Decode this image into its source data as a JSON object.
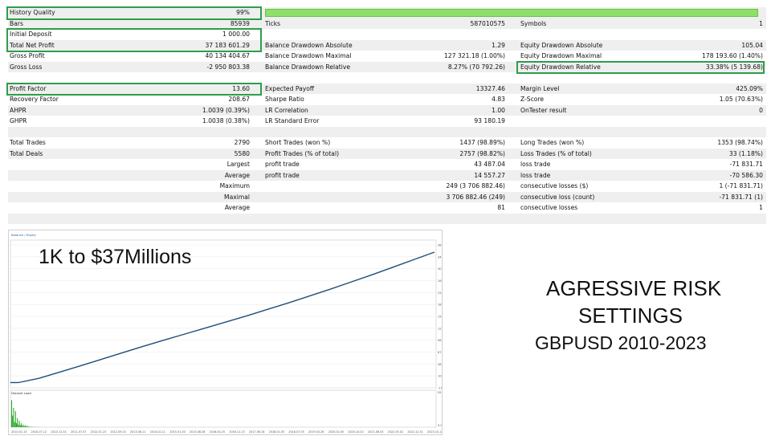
{
  "report": {
    "rows": [
      {
        "shade": true,
        "c1l": "History Quality",
        "c1v": "99%",
        "c2l": "",
        "c2v": "",
        "c3l": "",
        "c3v": "",
        "quality_fraction": 0.99
      },
      {
        "shade": true,
        "c1l": "Bars",
        "c1v": "85939",
        "c2l": "Ticks",
        "c2v": "587010575",
        "c3l": "Symbols",
        "c3v": "1"
      },
      {
        "shade": false,
        "c1l": "Initial Deposit",
        "c1v": "1 000.00",
        "c2l": "",
        "c2v": "",
        "c3l": "",
        "c3v": ""
      },
      {
        "shade": true,
        "c1l": "Total Net Profit",
        "c1v": "37 183 601.29",
        "c2l": "Balance Drawdown Absolute",
        "c2v": "1.29",
        "c3l": "Equity Drawdown Absolute",
        "c3v": "105.04"
      },
      {
        "shade": false,
        "c1l": "Gross Profit",
        "c1v": "40 134 404.67",
        "c2l": "Balance Drawdown Maximal",
        "c2v": "127 321.18 (1.00%)",
        "c3l": "Equity Drawdown Maximal",
        "c3v": "178 193.60 (1.40%)"
      },
      {
        "shade": true,
        "c1l": "Gross Loss",
        "c1v": "-2 950 803.38",
        "c2l": "Balance Drawdown Relative",
        "c2v": "8.27% (70 792.26)",
        "c3l": "Equity Drawdown Relative",
        "c3v": "33.38% (5 139.68)"
      },
      {
        "shade": false,
        "c1l": "",
        "c1v": "",
        "c2l": "",
        "c2v": "",
        "c3l": "",
        "c3v": ""
      },
      {
        "shade": true,
        "c1l": "Profit Factor",
        "c1v": "13.60",
        "c2l": "Expected Payoff",
        "c2v": "13327.46",
        "c3l": "Margin Level",
        "c3v": "425.09%"
      },
      {
        "shade": false,
        "c1l": "Recovery Factor",
        "c1v": "208.67",
        "c2l": "Sharpe Ratio",
        "c2v": "4.83",
        "c3l": "Z-Score",
        "c3v": "1.05 (70.63%)"
      },
      {
        "shade": true,
        "c1l": "AHPR",
        "c1v": "1.0039 (0.39%)",
        "c2l": "LR Correlation",
        "c2v": "1.00",
        "c3l": "OnTester result",
        "c3v": "0"
      },
      {
        "shade": false,
        "c1l": "GHPR",
        "c1v": "1.0038 (0.38%)",
        "c2l": "LR Standard Error",
        "c2v": "93 180.19",
        "c3l": "",
        "c3v": ""
      },
      {
        "shade": true,
        "c1l": "",
        "c1v": "",
        "c2l": "",
        "c2v": "",
        "c3l": "",
        "c3v": ""
      },
      {
        "shade": false,
        "c1l": "Total Trades",
        "c1v": "2790",
        "c2l": "Short Trades (won %)",
        "c2v": "1437 (98.89%)",
        "c3l": "Long Trades (won %)",
        "c3v": "1353 (98.74%)"
      },
      {
        "shade": true,
        "c1l": "Total Deals",
        "c1v": "5580",
        "c2l": "Profit Trades (% of total)",
        "c2v": "2757 (98.82%)",
        "c3l": "Loss Trades (% of total)",
        "c3v": "33 (1.18%)"
      },
      {
        "shade": false,
        "c1l": "",
        "c1v": "Largest",
        "c2l": "profit trade",
        "c2v": "43 487.04",
        "c3l": "loss trade",
        "c3v": "-71 831.71"
      },
      {
        "shade": true,
        "c1l": "",
        "c1v": "Average",
        "c2l": "profit trade",
        "c2v": "14 557.27",
        "c3l": "loss trade",
        "c3v": "-70 586.30"
      },
      {
        "shade": false,
        "c1l": "",
        "c1v": "Maximum",
        "c2l": "",
        "c2v": "249 (3 706 882.46)",
        "c3l": "consecutive losses ($)",
        "c3v": "1 (-71 831.71)"
      },
      {
        "shade": true,
        "c1l": "",
        "c1v": "Maximal",
        "c2l": "",
        "c2v": "3 706 882.46 (249)",
        "c3l": "consecutive loss (count)",
        "c3v": "-71 831.71 (1)"
      },
      {
        "shade": false,
        "c1l": "",
        "c1v": "Average",
        "c2l": "",
        "c2v": "81",
        "c3l": "consecutive losses",
        "c3v": "1"
      },
      {
        "shade": true,
        "c1l": "",
        "c1v": "",
        "c2l": "",
        "c2v": "",
        "c3l": "",
        "c3v": ""
      }
    ]
  },
  "overlay": {
    "headline": "1K to $37Millions",
    "side_line1": "AGRESSIVE RISK",
    "side_line2": "SETTINGS",
    "side_line3": "GBPUSD 2010-2023"
  },
  "chart_data": {
    "type": "line",
    "legend": "Balance / Equity",
    "title": "",
    "xlabel": "",
    "ylabel": "",
    "colors": {
      "balance": "#1f4e79",
      "deposit_load": "#1fa51f"
    },
    "y_ticks": [
      "38303231",
      "34434001",
      "30565876",
      "26697190",
      "22828510",
      "18959830",
      "15091150",
      "12221790",
      "9618430",
      "6747750",
      "3679070",
      "1001590",
      "-1459290"
    ],
    "x_ticks": [
      "2010.01.13",
      "2010.07.12",
      "2010.12.31",
      "2011.07.07",
      "2012.01.23",
      "2012.09.20",
      "2013.06.11",
      "2014.02.11",
      "2015.01.30",
      "2015.08.26",
      "2016.04.25",
      "2016.11.15",
      "2017.06.16",
      "2018.01.05",
      "2018.07.05",
      "2019.03.26",
      "2020.02.05",
      "2020.10.02",
      "2021.06.03",
      "2022.05.02",
      "2022.12.31",
      "2023.10.13"
    ],
    "x_index": [
      0,
      5,
      10,
      15,
      20,
      25,
      30,
      35,
      40,
      45,
      50,
      55,
      60,
      65,
      70,
      75,
      80,
      85,
      90,
      95,
      100
    ],
    "balance": [
      1000,
      1200000,
      2950000,
      4700000,
      6500000,
      8300000,
      10100000,
      11800000,
      13500000,
      15200000,
      16900000,
      18600000,
      20400000,
      22200000,
      24100000,
      26000000,
      28000000,
      30000000,
      32100000,
      34200000,
      36300000
    ],
    "ylim": [
      -1459290,
      38303231
    ],
    "deposit_load": {
      "label": "Deposit Load",
      "y_ticks": [
        "55.0%",
        "0.0%"
      ],
      "ylim": [
        0,
        55
      ],
      "values": [
        42,
        18,
        30,
        8,
        25,
        6,
        14,
        4,
        10,
        3,
        6,
        2,
        4,
        1.5,
        3,
        1,
        2,
        1,
        0.8,
        0.6,
        0.5,
        0.4,
        0.3,
        0.3,
        0.2,
        0.2,
        0.2,
        0.1,
        0.1,
        0.1
      ]
    }
  }
}
